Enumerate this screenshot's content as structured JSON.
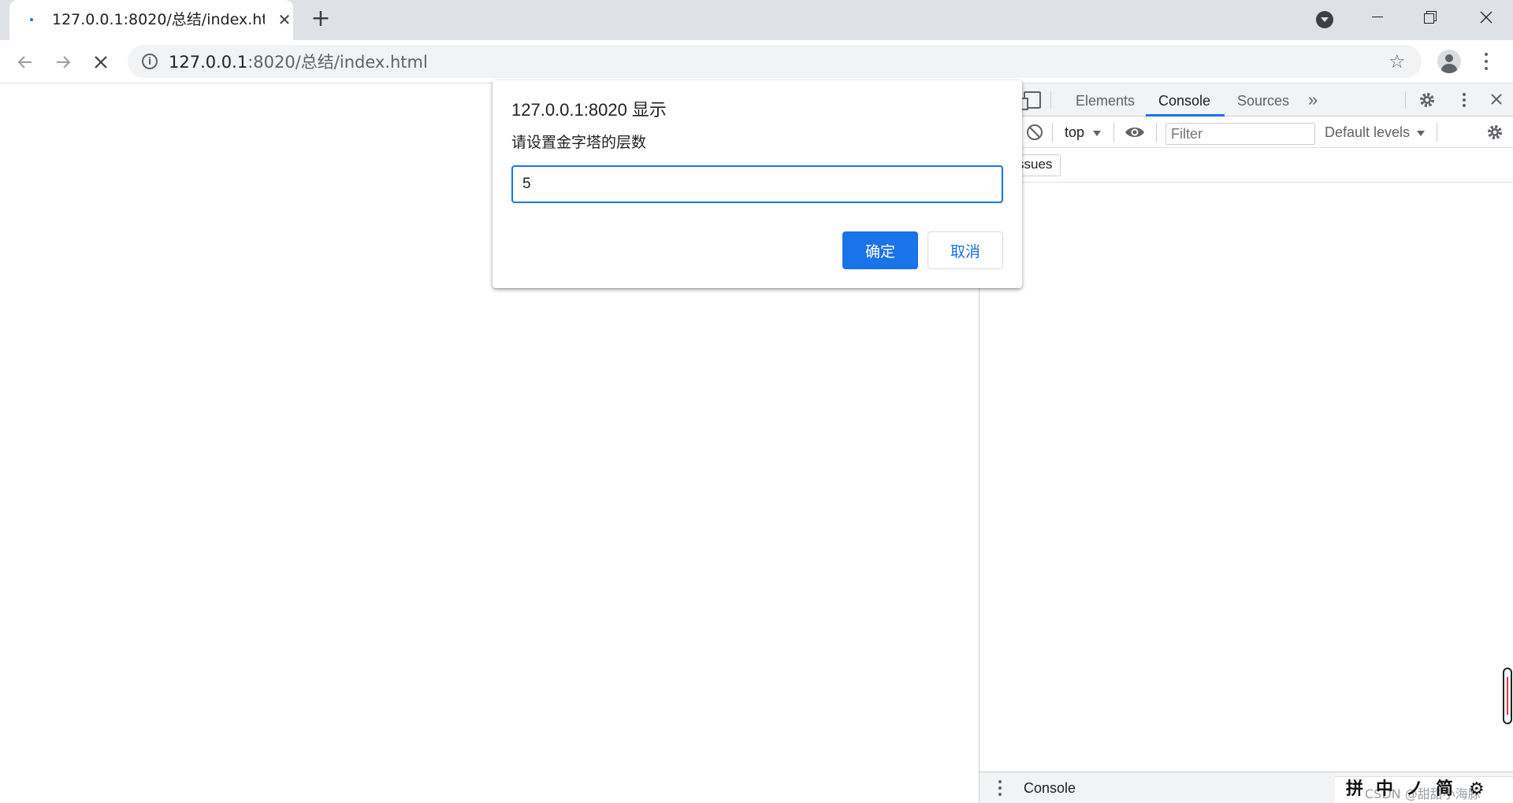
{
  "browser": {
    "tab": {
      "title": "127.0.0.1:8020/总结/index.html"
    },
    "address_bar": {
      "host": "127.0.0.1",
      "path": ":8020/总结/index.html"
    }
  },
  "devtools": {
    "tabs": [
      {
        "label": "Elements",
        "active": false
      },
      {
        "label": "Console",
        "active": true
      },
      {
        "label": "Sources",
        "active": false
      }
    ],
    "console_toolbar": {
      "context": "top",
      "filter_placeholder": "Filter",
      "levels": "Default levels"
    },
    "issues_label": "ssues",
    "drawer_title": "Console"
  },
  "dialog": {
    "title": "127.0.0.1:8020 显示",
    "message": "请设置金字塔的层数",
    "input_value": "5",
    "ok_label": "确定",
    "cancel_label": "取消"
  },
  "ime_toolbar": {
    "items": [
      "拼",
      "中",
      "ノ",
      "简",
      "⚙"
    ],
    "watermark": "CSDN @甜甜小海豚"
  },
  "colors": {
    "accent": "#1a73e8",
    "tabstrip": "#dee1e6",
    "devtools_bg": "#f1f3f4"
  }
}
